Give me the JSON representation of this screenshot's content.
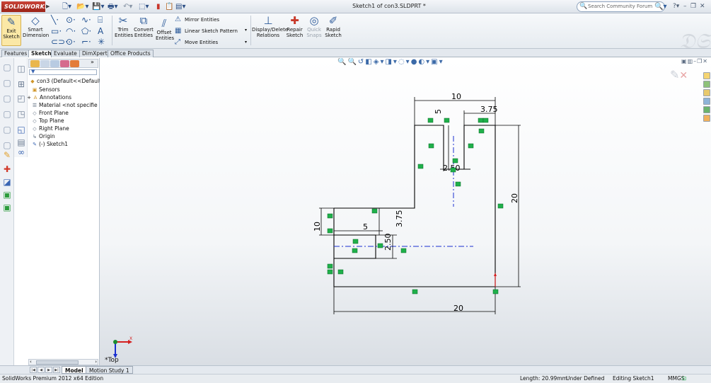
{
  "titlebar": {
    "app_logo": "SOLIDWORKS",
    "document_title": "Sketch1 of con3.SLDPRT *",
    "search_placeholder": "Search Community Forum"
  },
  "commands": {
    "exit_sketch": "Exit Sketch",
    "smart_dimension": "Smart Dimension",
    "trim_entities": "Trim Entities",
    "convert_entities": "Convert Entities",
    "offset_entities": "Offset Entities",
    "mirror_entities": "Mirror Entities",
    "linear_sketch_pattern": "Linear Sketch Pattern",
    "move_entities": "Move Entities",
    "display_delete_relations": "Display/Delete Relations",
    "repair_sketch": "Repair Sketch",
    "quick_snaps": "Quick Snaps",
    "rapid_sketch": "Rapid Sketch"
  },
  "tabs": [
    "Features",
    "Sketch",
    "Evaluate",
    "DimXpert",
    "Office Products"
  ],
  "active_tab": "Sketch",
  "feature_tree": {
    "root": "con3  (Default<<Default",
    "items": [
      "Sensors",
      "Annotations",
      "Material <not specifie",
      "Front Plane",
      "Top Plane",
      "Right Plane",
      "Origin",
      "(-) Sketch1"
    ]
  },
  "sketch": {
    "dimensions": {
      "top_width": "10",
      "top_right_width": "3.75",
      "slot_depth": "5",
      "slot_width": "2.50",
      "right_height": "20",
      "left_height": "10",
      "left_slot_depth": "5",
      "left_slot_width": "3.75",
      "left_slot_opening": "2.50",
      "bottom_width": "20"
    },
    "view_orientation": "*Top",
    "colors": {
      "geometry": "#000000",
      "dimension": "#000000",
      "centerline": "#1a2fd0",
      "relation": "#1fb04a"
    }
  },
  "bottom_tabs": [
    "Model",
    "Motion Study 1"
  ],
  "active_bottom_tab": "Model",
  "status": {
    "edition": "SolidWorks Premium 2012 x64 Edition",
    "length": "Length: 20.99mm",
    "definition": "Under Defined",
    "mode": "Editing Sketch1",
    "units": "MMGS"
  }
}
